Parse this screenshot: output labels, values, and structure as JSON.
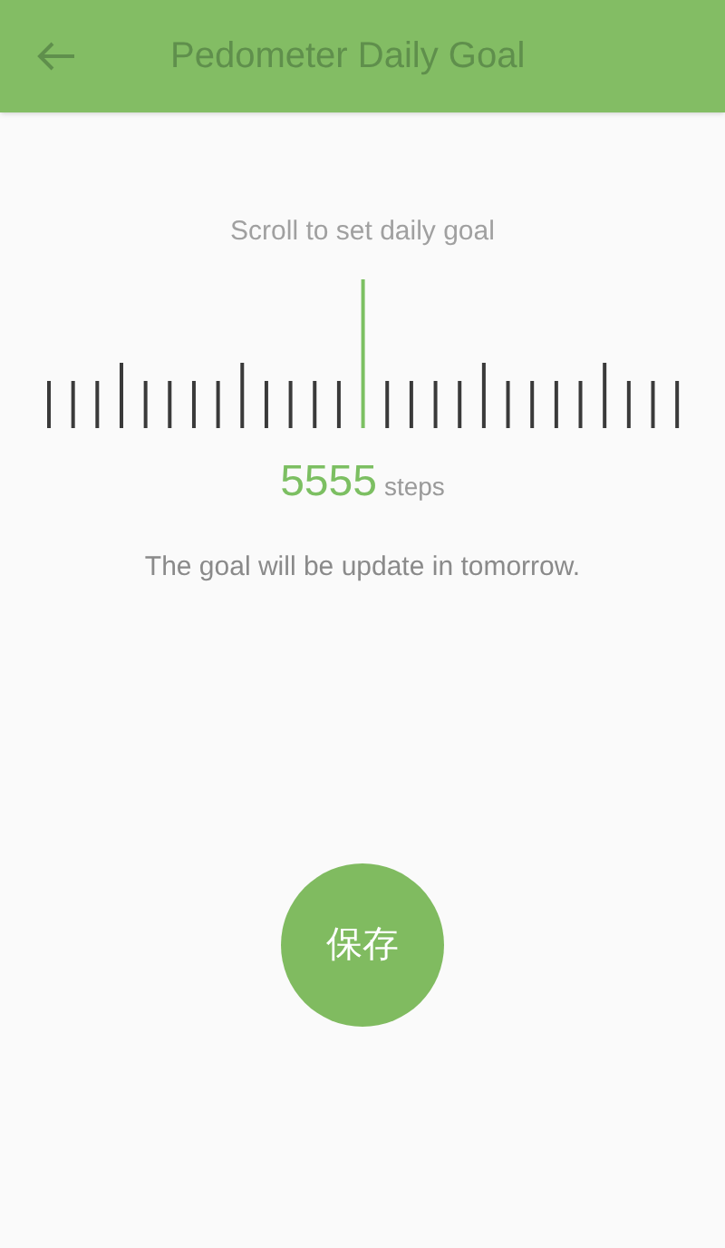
{
  "header": {
    "title": "Pedometer Daily Goal"
  },
  "goal": {
    "hint": "Scroll to set daily goal",
    "value": "5555",
    "unit": "steps",
    "note": "The goal will be update in tomorrow."
  },
  "save_button": {
    "label": "保存"
  }
}
